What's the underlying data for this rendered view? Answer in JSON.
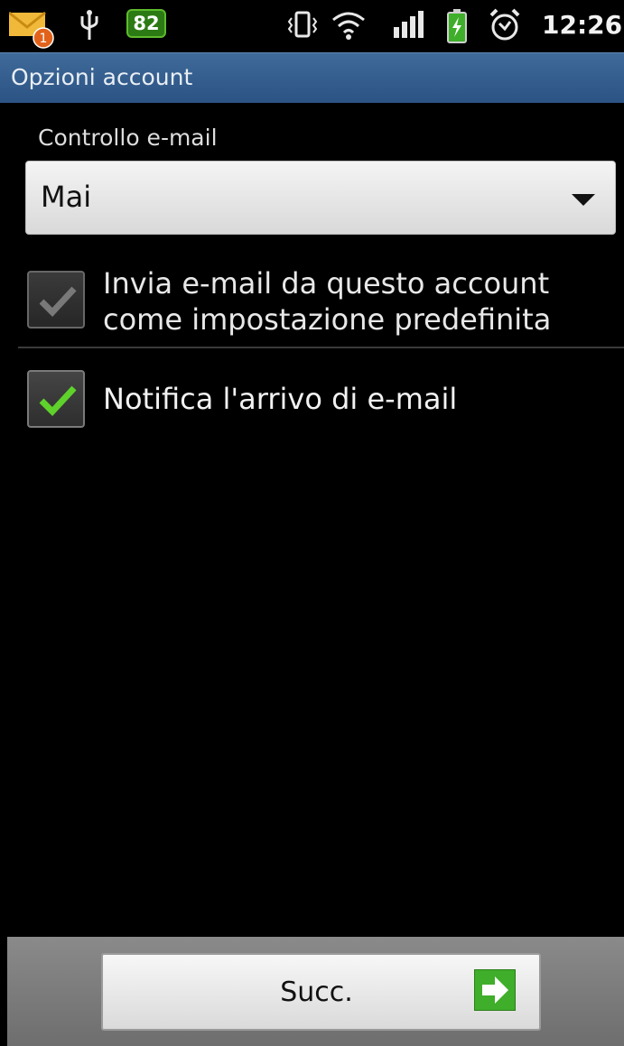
{
  "status_bar": {
    "notification_count": "1",
    "battery_level": "82",
    "time": "12:26",
    "icons": [
      "mail-icon",
      "usb-icon",
      "vibrate-icon",
      "wifi-icon",
      "signal-icon",
      "battery-charging-icon",
      "alarm-icon"
    ],
    "battery_badge_color": "#2c7a14"
  },
  "title_bar": {
    "title": "Opzioni account",
    "color": "#2b5384"
  },
  "email_check": {
    "label": "Controllo e-mail",
    "selected_value": "Mai"
  },
  "options": [
    {
      "label": "Invia e-mail da questo account come impostazione predefinita",
      "checked": true,
      "enabled": false
    },
    {
      "label": "Notifica l'arrivo di e-mail",
      "checked": true,
      "enabled": true
    }
  ],
  "footer": {
    "next_label": "Succ.",
    "arrow_color": "#3fae2a"
  }
}
